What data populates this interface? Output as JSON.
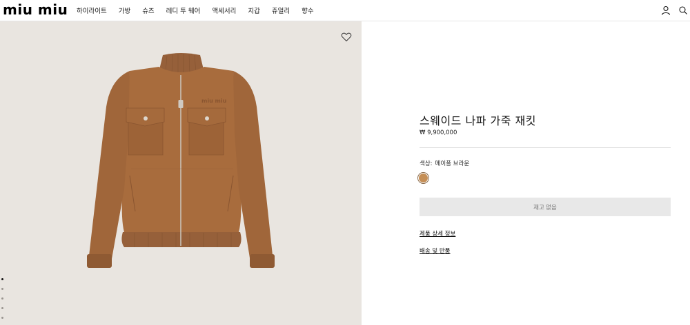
{
  "header": {
    "logo": "miu miu",
    "nav": [
      "하이라이트",
      "가방",
      "슈즈",
      "레디 투 웨어",
      "액세서리",
      "지갑",
      "쥬얼리",
      "향수"
    ]
  },
  "product": {
    "title": "스웨이드 나파 가죽 재킷",
    "price": "₩ 9,900,000",
    "color_label": "색상:",
    "color_value": "메이플 브라운",
    "swatch_color": "#c58f57",
    "stock_button": "재고 없음",
    "links": [
      "제품 상세 정보",
      "배송 및 반품"
    ]
  },
  "gallery": {
    "image_count": 5,
    "active_index": 0
  },
  "colors": {
    "image_background": "#e9e5e0",
    "jacket": "#a86c3d"
  }
}
